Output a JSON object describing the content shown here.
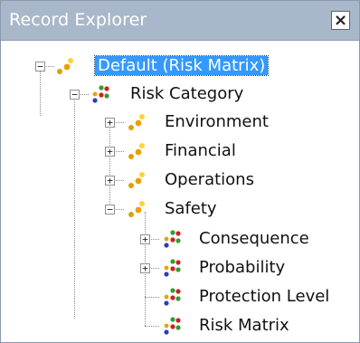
{
  "panel": {
    "title": "Record Explorer",
    "close_label": "×"
  },
  "tree": [
    {
      "label": "Default (Risk Matrix)",
      "selected": true,
      "expander": "minus",
      "icon": "family-icon-gold"
    },
    {
      "label": "Risk Category",
      "expander": "minus",
      "icon": "family-icon-multi"
    },
    {
      "label": "Environment",
      "expander": "plus",
      "icon": "family-icon-gold"
    },
    {
      "label": "Financial",
      "expander": "plus",
      "icon": "family-icon-gold"
    },
    {
      "label": "Operations",
      "expander": "plus",
      "icon": "family-icon-gold"
    },
    {
      "label": "Safety",
      "expander": "minus",
      "icon": "family-icon-gold"
    },
    {
      "label": "Consequence",
      "expander": "plus",
      "icon": "family-icon-multi"
    },
    {
      "label": "Probability",
      "expander": "plus",
      "icon": "family-icon-multi"
    },
    {
      "label": "Protection Level",
      "expander": "none",
      "icon": "family-icon-multi"
    },
    {
      "label": "Risk Matrix",
      "expander": "none",
      "icon": "family-icon-multi"
    }
  ],
  "colors": {
    "titlebar": "#a9b7ca",
    "selection": "#3399ff",
    "border": "#8a99ad"
  }
}
